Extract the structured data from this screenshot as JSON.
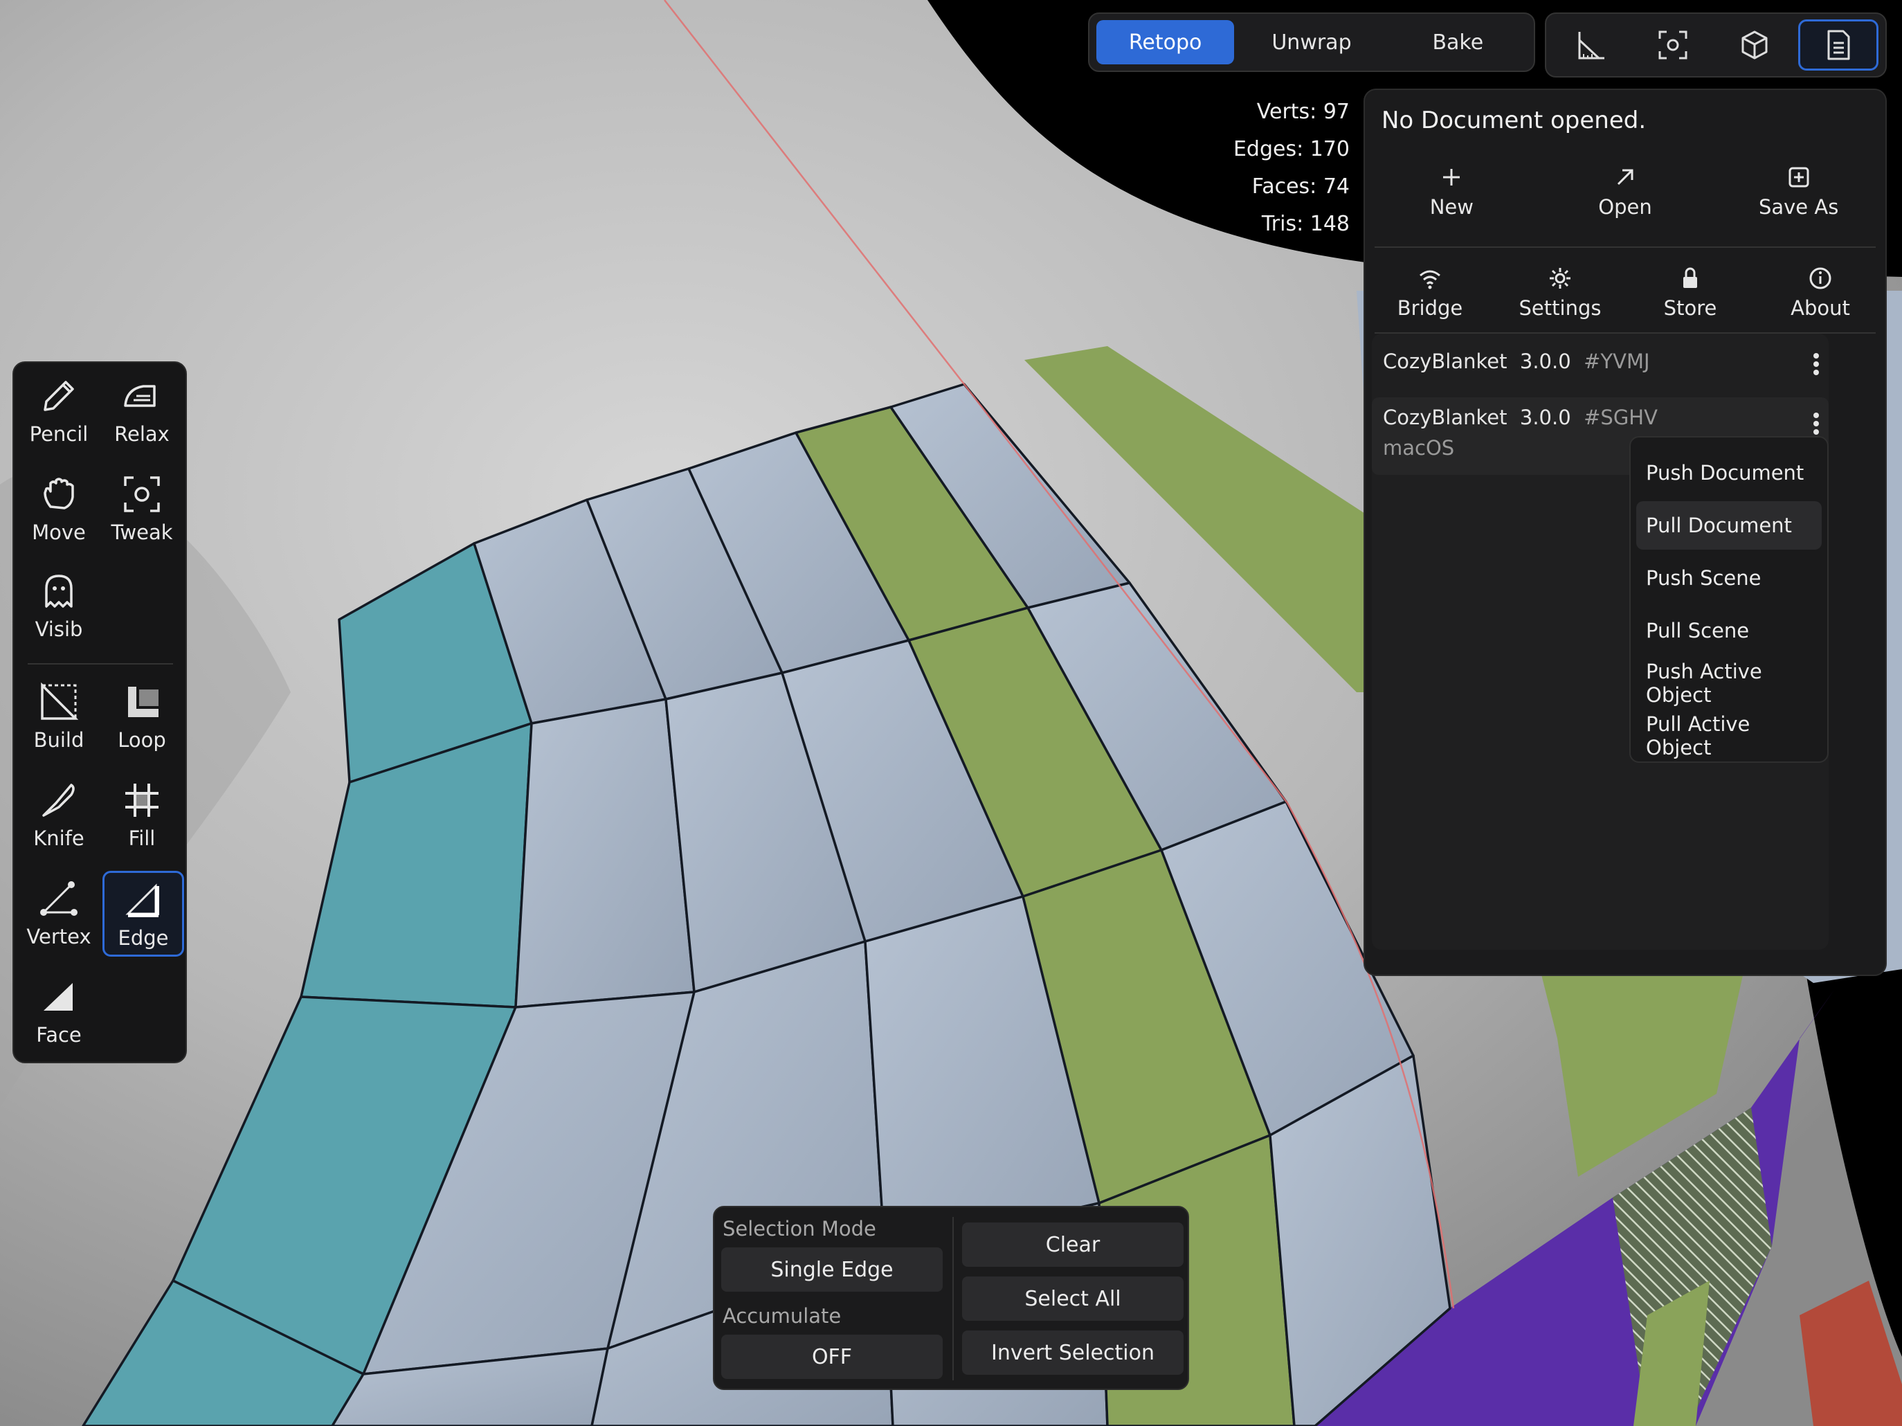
{
  "modes": [
    {
      "label": "Retopo",
      "active": true
    },
    {
      "label": "Unwrap",
      "active": false
    },
    {
      "label": "Bake",
      "active": false
    }
  ],
  "top_icons": [
    "measure-icon",
    "frame-focus-icon",
    "cube-icon",
    "document-icon"
  ],
  "stats": {
    "verts": "Verts: 97",
    "edges": "Edges: 170",
    "faces": "Faces: 74",
    "tris": "Tris: 148"
  },
  "document": {
    "title": "No Document opened.",
    "new_label": "New",
    "open_label": "Open",
    "save_as_label": "Save As",
    "bridge_label": "Bridge",
    "settings_label": "Settings",
    "store_label": "Store",
    "about_label": "About"
  },
  "devices": [
    {
      "name": "CozyBlanket",
      "version": "3.0.0",
      "hash": "#YVMJ",
      "os": ""
    },
    {
      "name": "CozyBlanket",
      "version": "3.0.0",
      "hash": "#SGHV",
      "os": "macOS"
    }
  ],
  "context_menu": [
    "Push Document",
    "Pull Document",
    "Push Scene",
    "Pull Scene",
    "Push Active Object",
    "Pull Active Object"
  ],
  "tools": {
    "pencil": "Pencil",
    "relax": "Relax",
    "move": "Move",
    "tweak": "Tweak",
    "visib": "Visib",
    "build": "Build",
    "loop": "Loop",
    "knife": "Knife",
    "fill": "Fill",
    "vertex": "Vertex",
    "edge": "Edge",
    "face": "Face"
  },
  "selection": {
    "mode_label": "Selection Mode",
    "mode_value": "Single Edge",
    "accumulate_label": "Accumulate",
    "accumulate_value": "OFF",
    "clear": "Clear",
    "select_all": "Select All",
    "invert": "Invert Selection"
  },
  "colors": {
    "accent": "#2e6ad6",
    "mesh_base": "#a9b6c8",
    "mesh_teal": "#5aa3ae",
    "mesh_green": "#8aa35a",
    "mesh_purple": "#5a2ea8",
    "sculpt_grey": "#bdbdbd"
  }
}
